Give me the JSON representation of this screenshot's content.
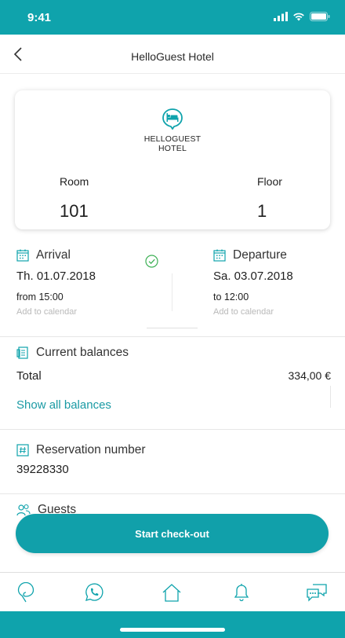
{
  "status_bar": {
    "time": "9:41"
  },
  "nav": {
    "title": "HelloGuest Hotel"
  },
  "hotel_card": {
    "logo_line1": "HELLOGUEST",
    "logo_line2": "HOTEL",
    "room_label": "Room",
    "room_value": "101",
    "floor_label": "Floor",
    "floor_value": "1"
  },
  "arrival": {
    "label": "Arrival",
    "date": "Th. 01.07.2018",
    "time": "from 15:00",
    "add_to_calendar": "Add to calendar"
  },
  "departure": {
    "label": "Departure",
    "date": "Sa. 03.07.2018",
    "time": "to 12:00",
    "add_to_calendar": "Add to calendar"
  },
  "balances": {
    "title": "Current balances",
    "total_label": "Total",
    "total_value": "334,00 €",
    "show_all": "Show all balances"
  },
  "reservation": {
    "title": "Reservation number",
    "number": "39228330"
  },
  "guests": {
    "title": "Guests"
  },
  "checkout_button": {
    "label": "Start check-out"
  },
  "tabs": [
    "map-pin-icon",
    "phone-icon",
    "home-icon",
    "bell-icon",
    "chat-icon"
  ],
  "colors": {
    "accent": "#0fa3ac",
    "link": "#1a9aa4",
    "check": "#3cb054"
  }
}
